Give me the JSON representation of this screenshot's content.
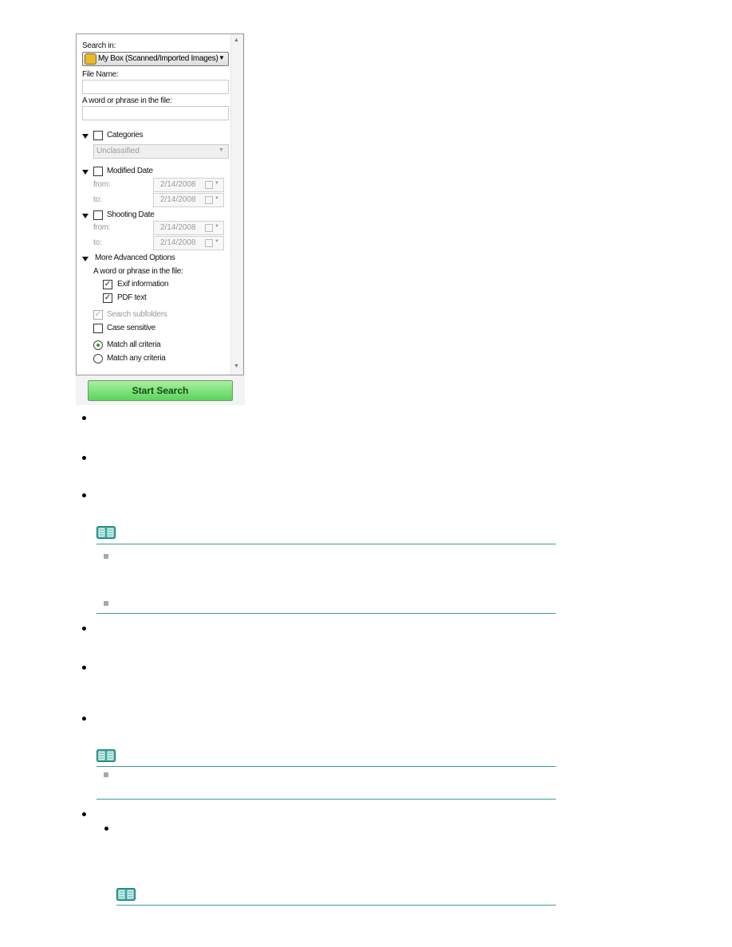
{
  "panel": {
    "search_in_label": "Search in:",
    "search_in_value": "My Box (Scanned/Imported Images)",
    "file_name_label": "File Name:",
    "file_name_value": "",
    "phrase_label": "A word or phrase in the file:",
    "phrase_value": "",
    "categories": {
      "label": "Categories",
      "checked": false,
      "value": "Unclassified"
    },
    "modified_date": {
      "label": "Modified Date",
      "checked": false,
      "from_label": "from:",
      "from_value": "2/14/2008",
      "to_label": "to:",
      "to_value": "2/14/2008"
    },
    "shooting_date": {
      "label": "Shooting Date",
      "checked": false,
      "from_label": "from:",
      "from_value": "2/14/2008",
      "to_label": "to:",
      "to_value": "2/14/2008"
    },
    "advanced": {
      "label": "More Advanced Options",
      "phrase_label": "A word or phrase in the file:",
      "exif": {
        "label": "Exif information",
        "checked": true
      },
      "pdf": {
        "label": "PDF text",
        "checked": true
      },
      "subfolders": {
        "label": "Search subfolders",
        "checked": true,
        "disabled": true
      },
      "case": {
        "label": "Case sensitive",
        "checked": false
      },
      "match_all": {
        "label": "Match all criteria",
        "selected": true
      },
      "match_any": {
        "label": "Match any criteria",
        "selected": false
      }
    },
    "start_button": "Start Search"
  },
  "icons": {
    "note": "book-icon",
    "box": "box-icon"
  },
  "colors": {
    "note_line": "#3a9a9a",
    "button_green": "#5ad45a"
  }
}
